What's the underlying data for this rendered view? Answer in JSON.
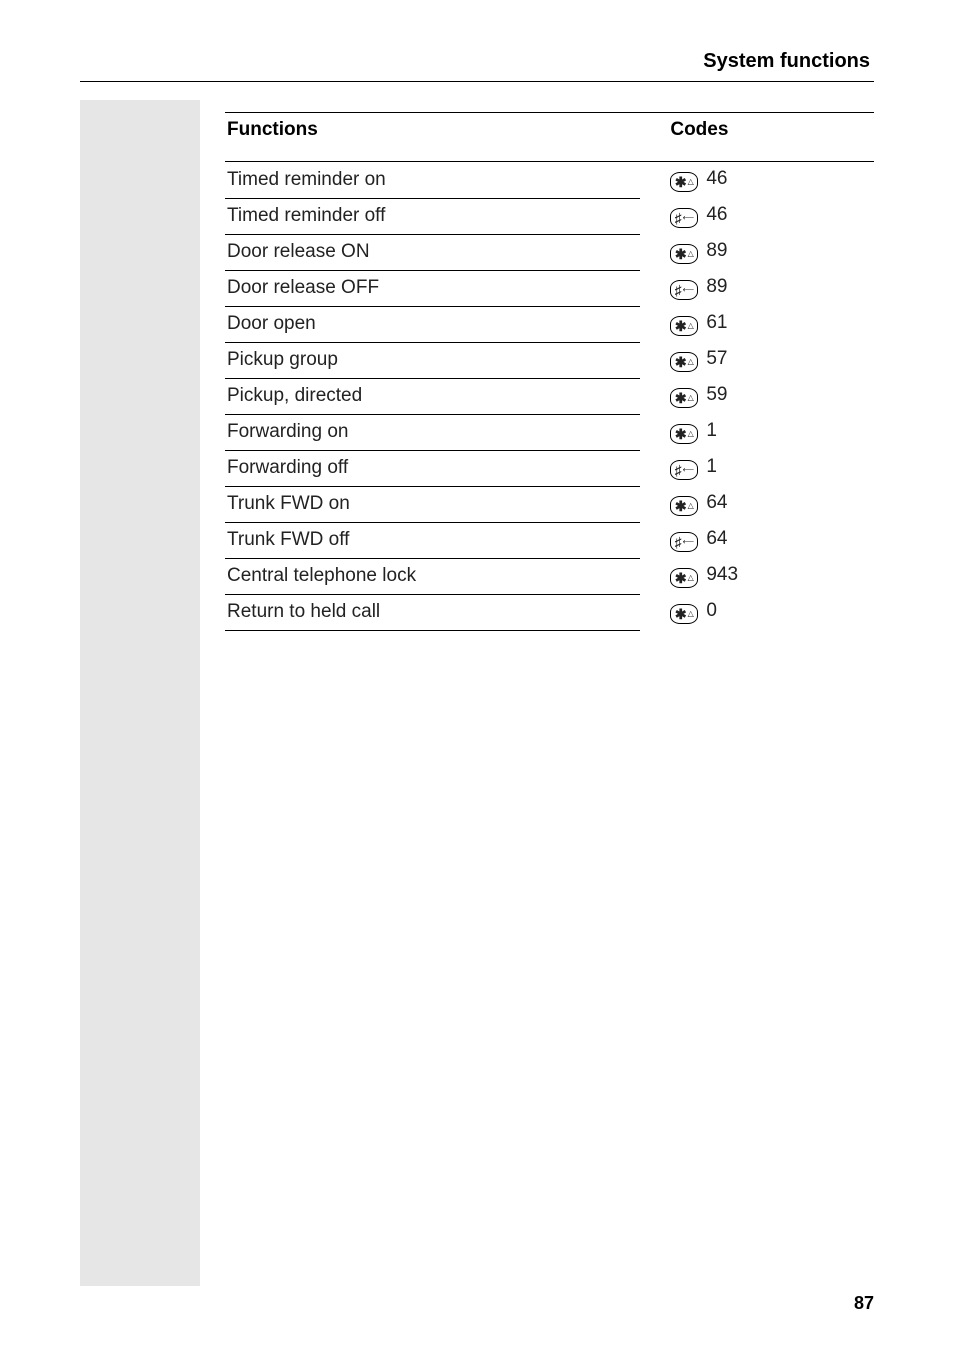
{
  "header": {
    "section_title": "System functions"
  },
  "table": {
    "headers": {
      "functions": "Functions",
      "codes": "Codes"
    },
    "rows": [
      {
        "fn": "Timed reminder on",
        "key": "star",
        "code": "46",
        "section_end": false
      },
      {
        "fn": "Timed reminder off",
        "key": "hash",
        "code": "46",
        "section_end": true
      },
      {
        "fn": "Door release ON",
        "key": "star",
        "code": "89",
        "section_end": false
      },
      {
        "fn": "Door release OFF",
        "key": "hash",
        "code": "89",
        "section_end": true
      },
      {
        "fn": "Door open",
        "key": "star",
        "code": "61",
        "section_end": true
      },
      {
        "fn": "Pickup group",
        "key": "star",
        "code": "57",
        "section_end": false
      },
      {
        "fn": "Pickup, directed",
        "key": "star",
        "code": "59",
        "section_end": true
      },
      {
        "fn": "Forwarding on",
        "key": "star",
        "code": "1",
        "section_end": false
      },
      {
        "fn": "Forwarding off",
        "key": "hash",
        "code": "1",
        "section_end": true
      },
      {
        "fn": "Trunk FWD on",
        "key": "star",
        "code": "64",
        "section_end": false
      },
      {
        "fn": "Trunk FWD off",
        "key": "hash",
        "code": "64",
        "section_end": true
      },
      {
        "fn": "Central telephone lock",
        "key": "star",
        "code": "943",
        "section_end": false
      },
      {
        "fn": "Return to held call",
        "key": "star",
        "code": "0",
        "section_end": false,
        "last": true
      }
    ]
  },
  "key_glyphs": {
    "star": {
      "main": "✱",
      "sub": "△"
    },
    "hash": {
      "main": "♯",
      "sub": "⟵"
    }
  },
  "footer": {
    "page_number": "87"
  }
}
